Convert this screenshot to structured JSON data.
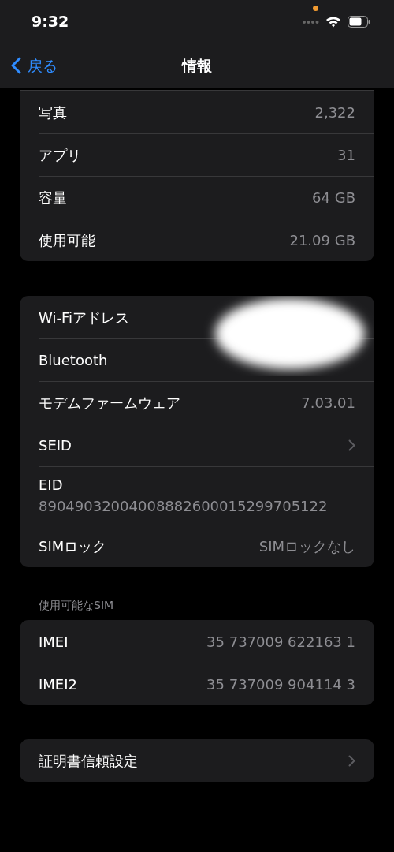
{
  "status_bar": {
    "time": "9:32"
  },
  "nav": {
    "back": "戻る",
    "title": "情報"
  },
  "groups": [
    {
      "cut_top": true,
      "rows": [
        {
          "kind": "value",
          "label": "写真",
          "value": "2,322"
        },
        {
          "kind": "value",
          "label": "アプリ",
          "value": "31"
        },
        {
          "kind": "value",
          "label": "容量",
          "value": "64 GB"
        },
        {
          "kind": "value",
          "label": "使用可能",
          "value": "21.09 GB"
        }
      ]
    },
    {
      "redacted": true,
      "rows": [
        {
          "kind": "value",
          "label": "Wi-Fiアドレス"
        },
        {
          "kind": "value",
          "label": "Bluetooth"
        },
        {
          "kind": "value",
          "label": "モデムファームウェア",
          "value": "7.03.01"
        },
        {
          "kind": "chevron",
          "label": "SEID"
        },
        {
          "kind": "stacked",
          "label": "EID",
          "value": "89049032004008882600015299705122"
        },
        {
          "kind": "value",
          "label": "SIMロック",
          "value": "SIMロックなし"
        }
      ]
    },
    {
      "header": "使用可能なSIM",
      "rows": [
        {
          "kind": "value",
          "label": "IMEI",
          "value": "35 737009 622163 1"
        },
        {
          "kind": "value",
          "label": "IMEI2",
          "value": "35 737009 904114 3"
        }
      ]
    },
    {
      "rows": [
        {
          "kind": "chevron",
          "label": "証明書信頼設定"
        }
      ]
    }
  ]
}
